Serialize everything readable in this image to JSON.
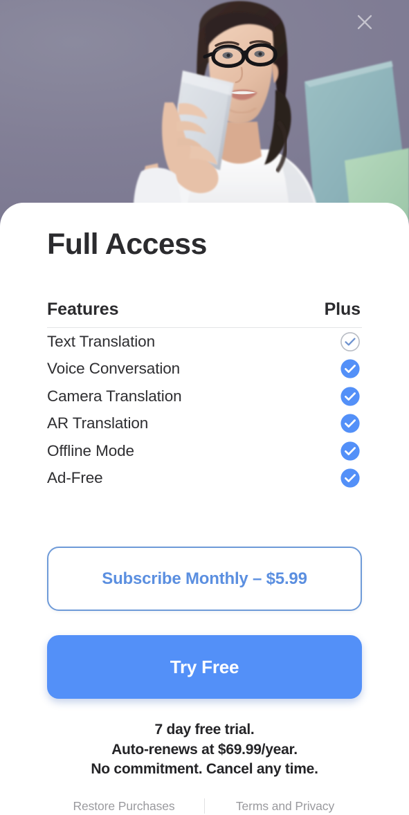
{
  "hero": {
    "alt": "woman with glasses holding a smartphone next to a laptop",
    "background_color": "#858399",
    "close_icon": "close-icon"
  },
  "card": {
    "title": "Full Access"
  },
  "table": {
    "columns": [
      "Features",
      "Plus"
    ],
    "rows": [
      {
        "feature": "Text Translation",
        "plus": true,
        "style": "outline"
      },
      {
        "feature": "Voice Conversation",
        "plus": true,
        "style": "filled"
      },
      {
        "feature": "Camera Translation",
        "plus": true,
        "style": "filled"
      },
      {
        "feature": "AR Translation",
        "plus": true,
        "style": "filled"
      },
      {
        "feature": "Offline Mode",
        "plus": true,
        "style": "filled"
      },
      {
        "feature": "Ad-Free",
        "plus": true,
        "style": "filled"
      }
    ]
  },
  "actions": {
    "subscribe_label": "Subscribe Monthly – $5.99",
    "try_free_label": "Try Free"
  },
  "disclaimer": {
    "line1": "7 day free trial.",
    "line2": "Auto-renews at $69.99/year.",
    "line3": "No commitment. Cancel any time."
  },
  "footer": {
    "restore_label": "Restore Purchases",
    "terms_label": "Terms and Privacy"
  },
  "colors": {
    "accent_blue": "#5390f8",
    "outline_blue": "#6e9ad8",
    "link_blue": "#5b8fe0",
    "check_blue": "#5390f8",
    "text_dark": "#2b2b2e",
    "muted": "#9a9a9e",
    "divider": "#e3e4e6",
    "hero_bg": "#858399"
  }
}
